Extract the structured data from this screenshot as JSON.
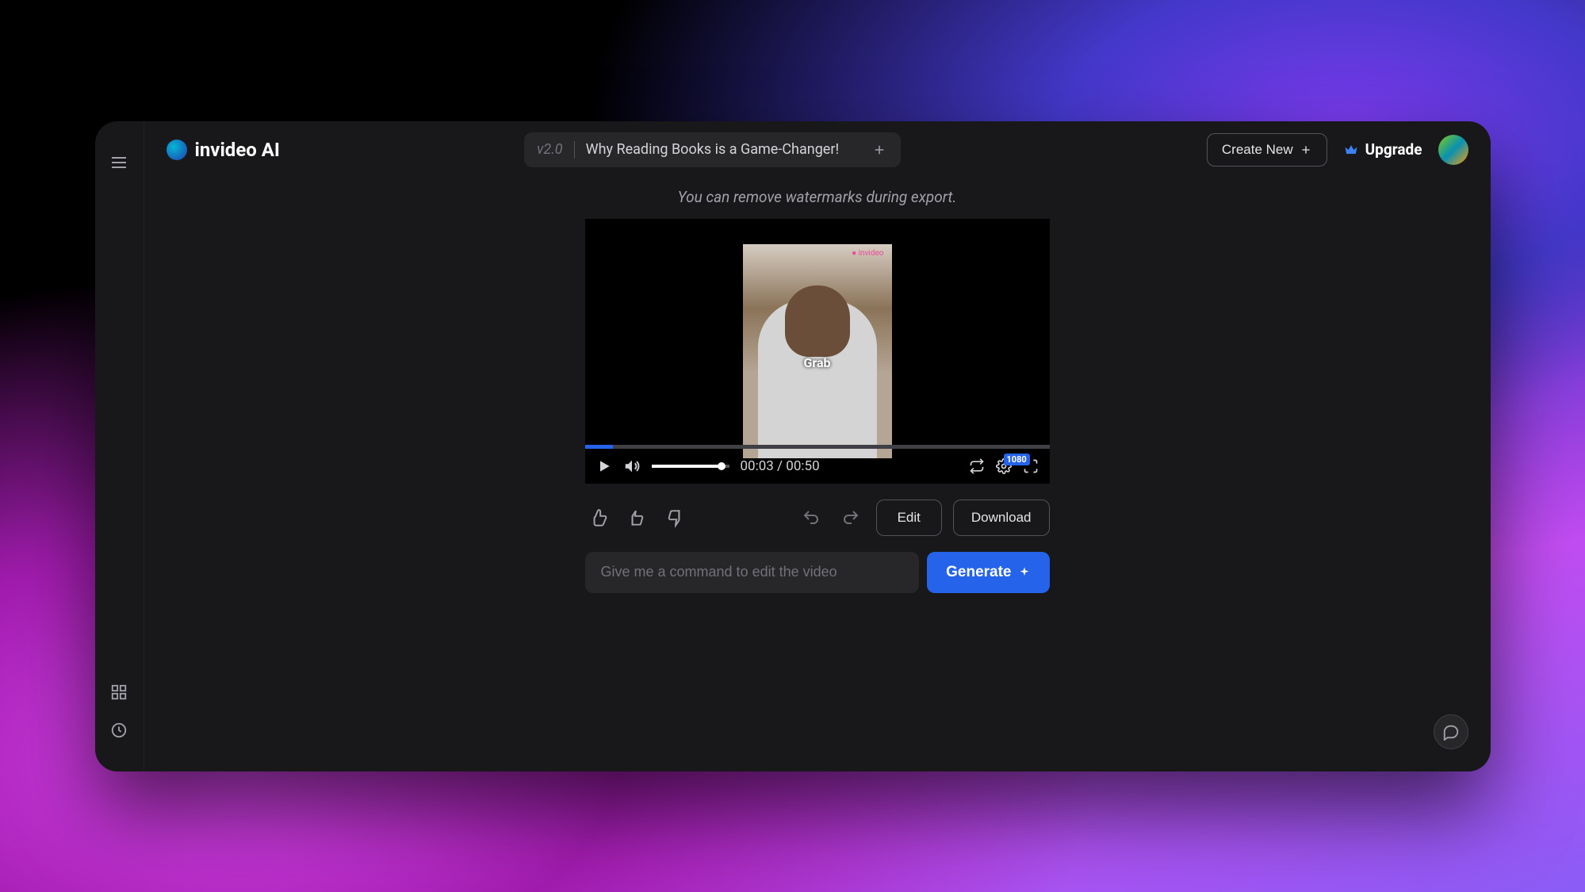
{
  "brand": {
    "name": "invideo AI"
  },
  "header": {
    "version": "v2.0",
    "title": "Why Reading Books is a Game-Changer!",
    "create_new_label": "Create New",
    "upgrade_label": "Upgrade"
  },
  "hint": "You can remove watermarks during export.",
  "video": {
    "caption": "Grab",
    "time_current": "00:03",
    "time_total": "00:50",
    "quality": "1080",
    "progress_percent": 6,
    "volume_percent": 90
  },
  "actions": {
    "edit_label": "Edit",
    "download_label": "Download"
  },
  "command": {
    "placeholder": "Give me a command to edit the video",
    "generate_label": "Generate"
  }
}
